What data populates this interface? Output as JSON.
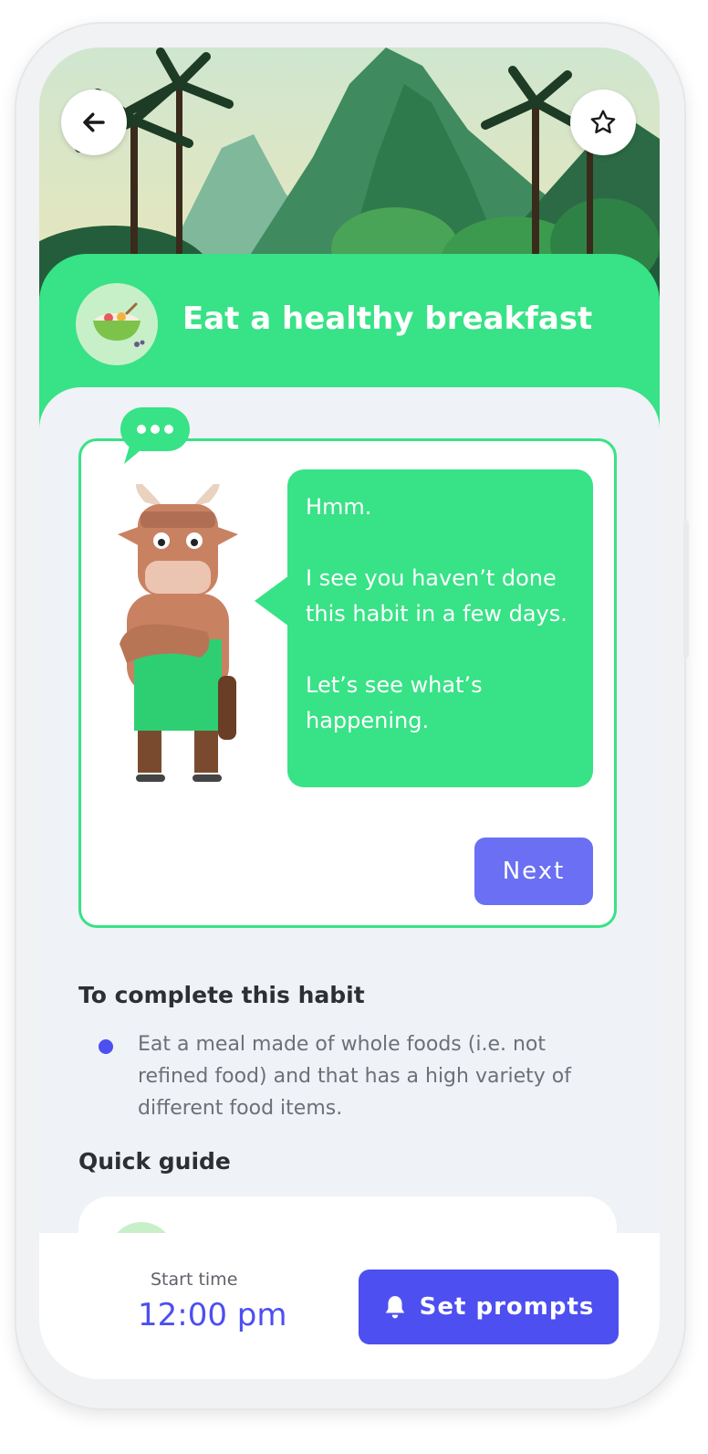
{
  "header": {
    "back_icon": "arrow-left-icon",
    "favorite_icon": "star-outline-icon",
    "habit_icon": "salad-bowl-icon",
    "title": "Eat a healthy breakfast"
  },
  "dialog": {
    "bubble_icon": "chat-ellipsis-icon",
    "mascot": "bull-mascot-icon",
    "messages": [
      "Hmm.",
      "I see you haven’t done this habit in a few days.",
      "Let’s see what’s happening."
    ],
    "next_label": "Next"
  },
  "completion": {
    "heading": "To complete this habit",
    "items": [
      "Eat a meal made of whole foods (i.e. not refined food) and that has a high variety of different food items."
    ]
  },
  "guide": {
    "heading": "Quick guide"
  },
  "footer": {
    "start_label": "Start time",
    "start_value": "12:00 pm",
    "prompts_label": "Set prompts",
    "bell_icon": "bell-icon"
  },
  "colors": {
    "accent_green": "#38e286",
    "primary_blue": "#4d4ff0",
    "next_button": "#6b6ff3",
    "background": "#eff2f6"
  }
}
